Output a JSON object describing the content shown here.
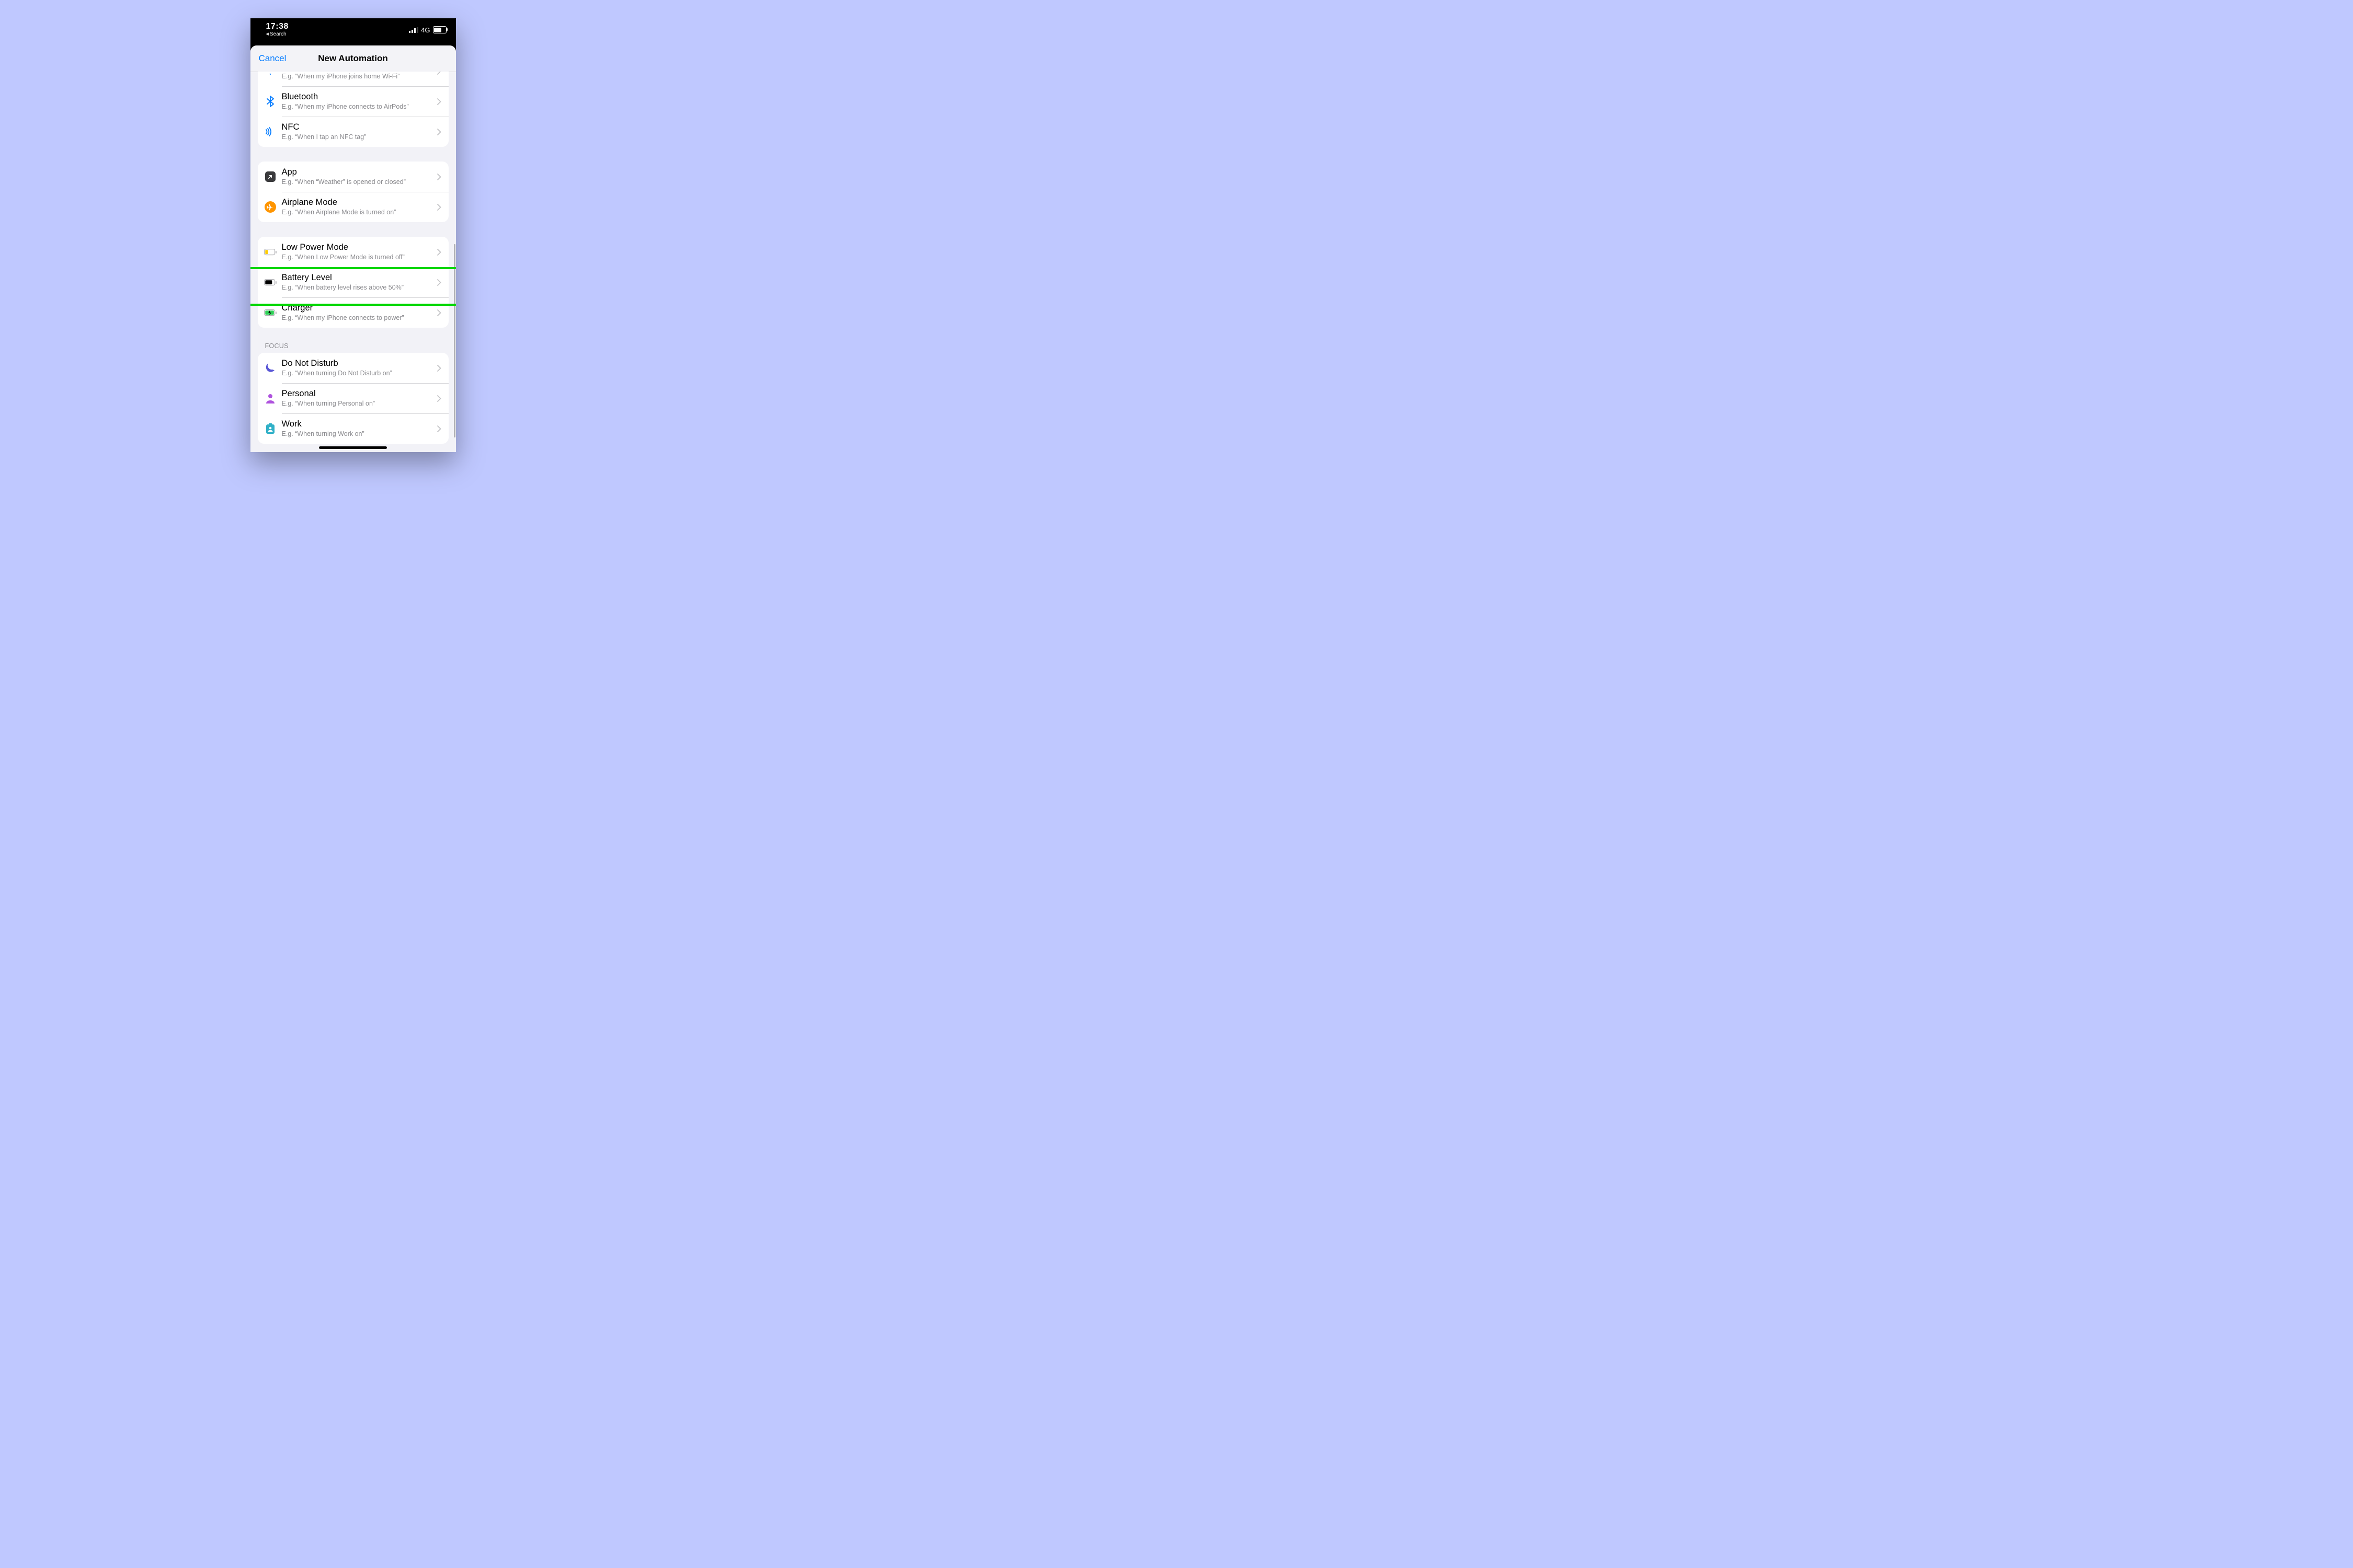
{
  "statusbar": {
    "time": "17:38",
    "back": "Search",
    "network_label": "4G"
  },
  "nav": {
    "cancel": "Cancel",
    "title": "New Automation"
  },
  "sections": {
    "prev_partial": {
      "sub": "E.g. “When my iPhone joins home Wi-Fi”"
    },
    "bluetooth": {
      "title": "Bluetooth",
      "sub": "E.g. “When my iPhone connects to AirPods”"
    },
    "nfc": {
      "title": "NFC",
      "sub": "E.g. “When I tap an NFC tag”"
    },
    "app": {
      "title": "App",
      "sub": "E.g. “When “Weather” is opened or closed”"
    },
    "airplane": {
      "title": "Airplane Mode",
      "sub": "E.g. “When Airplane Mode is turned on”"
    },
    "lowpower": {
      "title": "Low Power Mode",
      "sub": "E.g. “When Low Power Mode is turned off”"
    },
    "battery": {
      "title": "Battery Level",
      "sub": "E.g. “When battery level rises above 50%”"
    },
    "charger": {
      "title": "Charger",
      "sub": "E.g. “When my iPhone connects to power”"
    },
    "focus_header": "Focus",
    "dnd": {
      "title": "Do Not Disturb",
      "sub": "E.g. “When turning Do Not Disturb on”"
    },
    "personal": {
      "title": "Personal",
      "sub": "E.g. “When turning Personal on”"
    },
    "work": {
      "title": "Work",
      "sub": "E.g. “When turning Work on”"
    }
  },
  "annotation": {
    "highlighted_row": "row-battery-level"
  }
}
